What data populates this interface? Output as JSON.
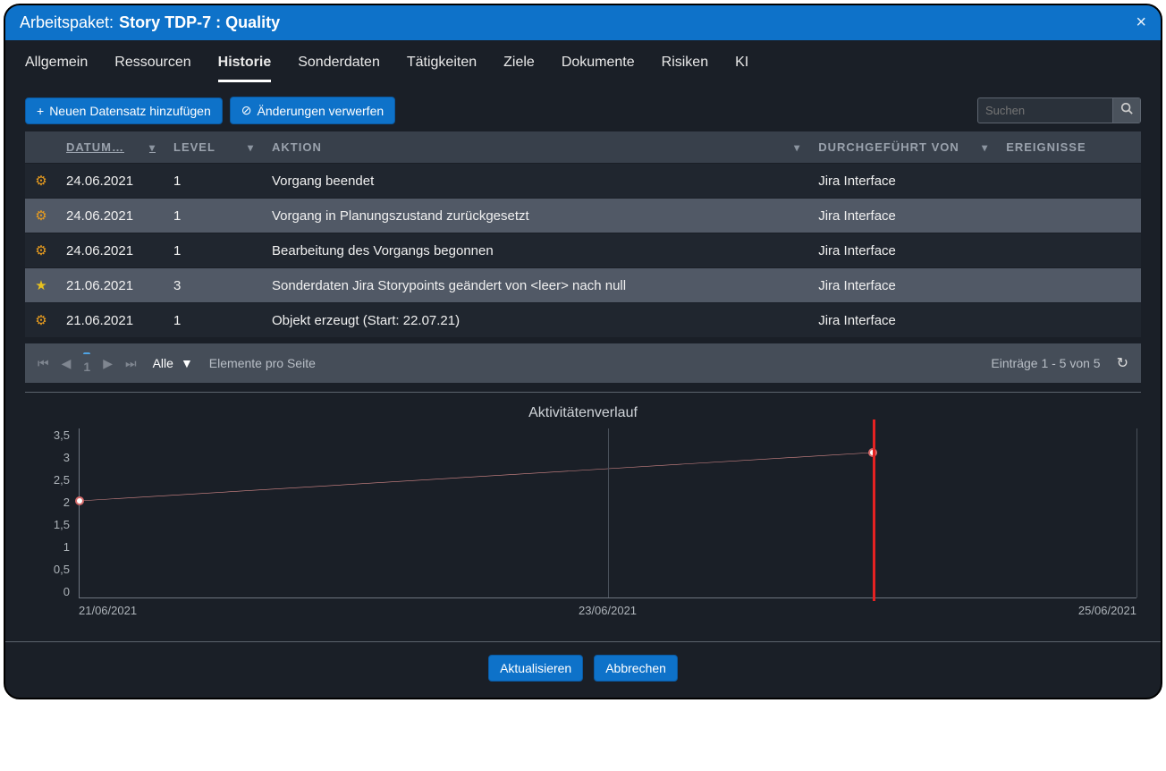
{
  "header": {
    "prefix": "Arbeitspaket:",
    "title": "Story TDP-7 : Quality",
    "close": "×"
  },
  "tabs": [
    {
      "label": "Allgemein",
      "active": false
    },
    {
      "label": "Ressourcen",
      "active": false
    },
    {
      "label": "Historie",
      "active": true
    },
    {
      "label": "Sonderdaten",
      "active": false
    },
    {
      "label": "Tätigkeiten",
      "active": false
    },
    {
      "label": "Ziele",
      "active": false
    },
    {
      "label": "Dokumente",
      "active": false
    },
    {
      "label": "Risiken",
      "active": false
    },
    {
      "label": "KI",
      "active": false
    }
  ],
  "toolbar": {
    "add_label": "Neuen Datensatz hinzufügen",
    "discard_label": "Änderungen verwerfen",
    "search_placeholder": "Suchen"
  },
  "table": {
    "headers": {
      "datum": "DATUM…",
      "level": "LEVEL",
      "aktion": "AKTION",
      "by": "DURCHGEFÜHRT VON",
      "events": "EREIGNISSE"
    },
    "rows": [
      {
        "icon": "gear",
        "datum": "24.06.2021",
        "level": "1",
        "aktion": "Vorgang beendet",
        "by": "Jira Interface",
        "events": ""
      },
      {
        "icon": "gear",
        "datum": "24.06.2021",
        "level": "1",
        "aktion": "Vorgang in Planungszustand zurückgesetzt",
        "by": "Jira Interface",
        "events": ""
      },
      {
        "icon": "gear",
        "datum": "24.06.2021",
        "level": "1",
        "aktion": "Bearbeitung des Vorgangs begonnen",
        "by": "Jira Interface",
        "events": ""
      },
      {
        "icon": "star",
        "datum": "21.06.2021",
        "level": "3",
        "aktion": "Sonderdaten Jira Storypoints geändert von <leer> nach null",
        "by": "Jira Interface",
        "events": ""
      },
      {
        "icon": "gear",
        "datum": "21.06.2021",
        "level": "1",
        "aktion": "Objekt erzeugt (Start: 22.07.21)",
        "by": "Jira Interface",
        "events": ""
      }
    ]
  },
  "pager": {
    "page": "1",
    "page_size": "Alle",
    "per_page_label": "Elemente pro Seite",
    "summary": "Einträge 1 - 5 von 5"
  },
  "chart_data": {
    "type": "line",
    "title": "Aktivitätenverlauf",
    "xlabel": "",
    "ylabel": "",
    "ylim": [
      0,
      3.5
    ],
    "y_ticks": [
      3.5,
      3,
      2.5,
      2,
      1.5,
      1,
      0.5,
      0
    ],
    "x_ticks": [
      "21/06/2021",
      "23/06/2021",
      "25/06/2021"
    ],
    "x": [
      "21/06/2021",
      "24/06/2021"
    ],
    "values": [
      2,
      3
    ],
    "marker_x": "24/06/2021"
  },
  "footer": {
    "update": "Aktualisieren",
    "cancel": "Abbrechen"
  }
}
